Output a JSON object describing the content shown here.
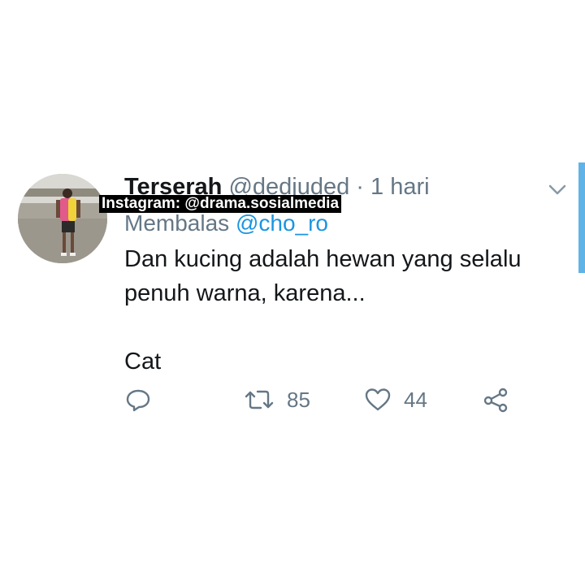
{
  "tweet": {
    "display_name": "Terserah",
    "handle": "@dedjuded",
    "separator": "·",
    "time": "1 hari",
    "reply_prefix": "Membalas",
    "reply_mention": "@cho_ro",
    "text_line1": "Dan kucing adalah hewan yang selalu",
    "text_line2": "penuh warna, karena...",
    "text_line3": "Cat",
    "avatar_icon": "profile-photo"
  },
  "watermark": {
    "text": "Instagram: @drama.sosialmedia"
  },
  "actions": {
    "reply_icon": "reply-icon",
    "retweet_icon": "retweet-icon",
    "retweet_count": "85",
    "like_icon": "heart-icon",
    "like_count": "44",
    "share_icon": "share-icon"
  },
  "colors": {
    "text_primary": "#14171a",
    "text_secondary": "#657786",
    "link": "#1b95e0",
    "accent_bar": "#5fb3e6"
  }
}
